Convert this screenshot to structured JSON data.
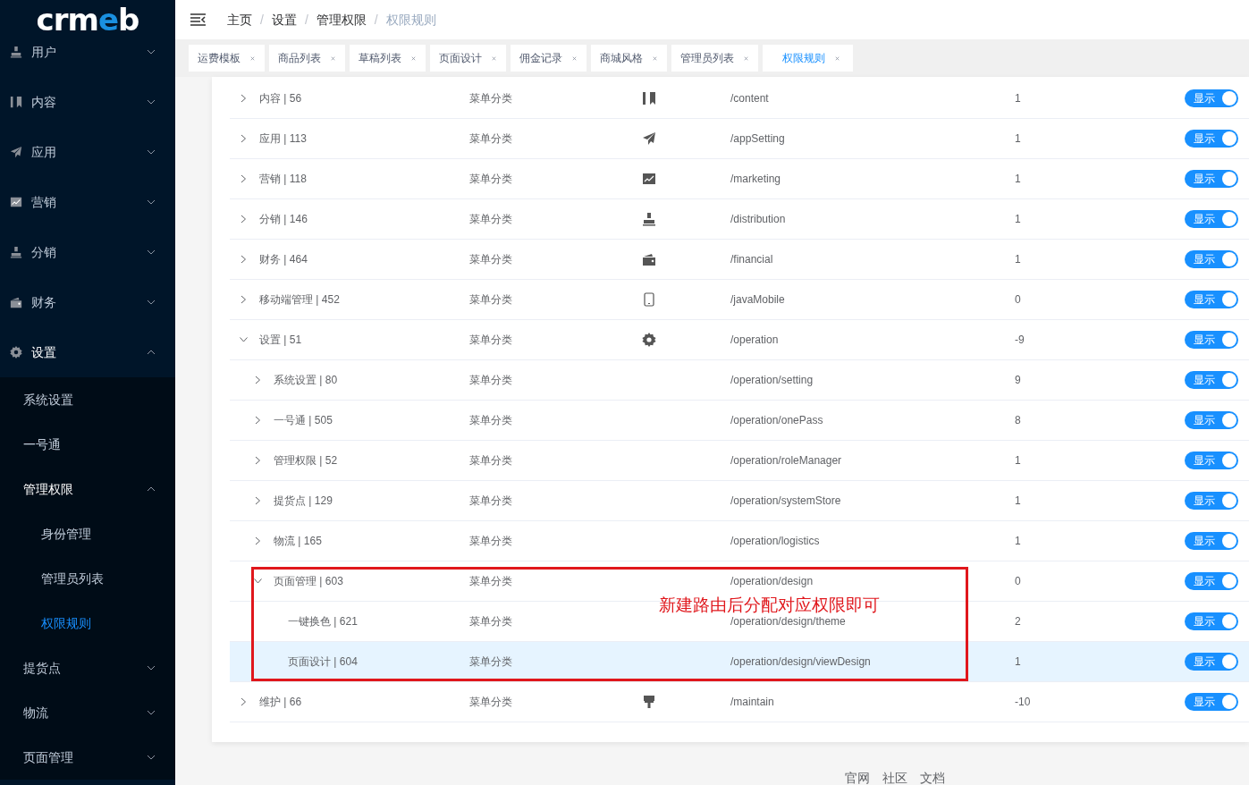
{
  "logo": "crmeb",
  "sidebar": {
    "items": [
      {
        "label": "用户",
        "expanded": false,
        "selected": false
      },
      {
        "label": "内容",
        "expanded": false,
        "selected": false
      },
      {
        "label": "应用",
        "expanded": false,
        "selected": false
      },
      {
        "label": "营销",
        "expanded": false,
        "selected": false
      },
      {
        "label": "分销",
        "expanded": false,
        "selected": false
      },
      {
        "label": "财务",
        "expanded": false,
        "selected": false
      },
      {
        "label": "设置",
        "expanded": true,
        "selected": false,
        "children": [
          {
            "label": "系统设置",
            "selected": false
          },
          {
            "label": "一号通",
            "selected": false
          },
          {
            "label": "管理权限",
            "expanded": true,
            "selected": false,
            "children": [
              {
                "label": "身份管理",
                "selected": false
              },
              {
                "label": "管理员列表",
                "selected": false
              },
              {
                "label": "权限规则",
                "selected": true
              }
            ]
          },
          {
            "label": "提货点",
            "expanded": false,
            "selected": false
          },
          {
            "label": "物流",
            "expanded": false,
            "selected": false
          },
          {
            "label": "页面管理",
            "expanded": false,
            "selected": false
          }
        ]
      }
    ]
  },
  "breadcrumb": {
    "separator": "/",
    "items": [
      "主页",
      "设置",
      "管理权限",
      "权限规则"
    ]
  },
  "tabs": [
    {
      "label": "运费模板",
      "selected": false
    },
    {
      "label": "商品列表",
      "selected": false
    },
    {
      "label": "草稿列表",
      "selected": false
    },
    {
      "label": "页面设计",
      "selected": false
    },
    {
      "label": "佣金记录",
      "selected": false
    },
    {
      "label": "商城风格",
      "selected": false
    },
    {
      "label": "管理员列表",
      "selected": false
    },
    {
      "label": "权限规则",
      "selected": true
    }
  ],
  "rules": [
    {
      "name": "内容 | 56",
      "type": "菜单分类",
      "path": "/content",
      "sort": "1",
      "status": {
        "label": "显示",
        "on": true
      },
      "expanded": false,
      "selected": false
    },
    {
      "name": "应用 | 113",
      "type": "菜单分类",
      "path": "/appSetting",
      "sort": "1",
      "status": {
        "label": "显示",
        "on": true
      },
      "expanded": false,
      "selected": false
    },
    {
      "name": "营销 | 118",
      "type": "菜单分类",
      "path": "/marketing",
      "sort": "1",
      "status": {
        "label": "显示",
        "on": true
      },
      "expanded": false,
      "selected": false
    },
    {
      "name": "分销 | 146",
      "type": "菜单分类",
      "path": "/distribution",
      "sort": "1",
      "status": {
        "label": "显示",
        "on": true
      },
      "expanded": false,
      "selected": false
    },
    {
      "name": "财务 | 464",
      "type": "菜单分类",
      "path": "/financial",
      "sort": "1",
      "status": {
        "label": "显示",
        "on": true
      },
      "expanded": false,
      "selected": false
    },
    {
      "name": "移动端管理 | 452",
      "type": "菜单分类",
      "path": "/javaMobile",
      "sort": "0",
      "status": {
        "label": "显示",
        "on": true
      },
      "expanded": false,
      "selected": false
    },
    {
      "name": "设置 | 51",
      "type": "菜单分类",
      "path": "/operation",
      "sort": "-9",
      "status": {
        "label": "显示",
        "on": true
      },
      "expanded": true,
      "selected": false,
      "children": [
        {
          "name": "系统设置 | 80",
          "type": "菜单分类",
          "path": "/operation/setting",
          "sort": "9",
          "status": {
            "label": "显示",
            "on": true
          },
          "expanded": false,
          "selected": false
        },
        {
          "name": "一号通 | 505",
          "type": "菜单分类",
          "path": "/operation/onePass",
          "sort": "8",
          "status": {
            "label": "显示",
            "on": true
          },
          "expanded": false,
          "selected": false
        },
        {
          "name": "管理权限 | 52",
          "type": "菜单分类",
          "path": "/operation/roleManager",
          "sort": "1",
          "status": {
            "label": "显示",
            "on": true
          },
          "expanded": false,
          "selected": false
        },
        {
          "name": "提货点 | 129",
          "type": "菜单分类",
          "path": "/operation/systemStore",
          "sort": "1",
          "status": {
            "label": "显示",
            "on": true
          },
          "expanded": false,
          "selected": false
        },
        {
          "name": "物流 | 165",
          "type": "菜单分类",
          "path": "/operation/logistics",
          "sort": "1",
          "status": {
            "label": "显示",
            "on": true
          },
          "expanded": false,
          "selected": false
        },
        {
          "name": "页面管理 | 603",
          "type": "菜单分类",
          "path": "/operation/design",
          "sort": "0",
          "status": {
            "label": "显示",
            "on": true
          },
          "expanded": true,
          "selected": false,
          "children": [
            {
              "name": "一键换色 | 621",
              "type": "菜单分类",
              "path": "/operation/design/theme",
              "sort": "2",
              "status": {
                "label": "显示",
                "on": true
              },
              "selected": false
            },
            {
              "name": "页面设计 | 604",
              "type": "菜单分类",
              "path": "/operation/design/viewDesign",
              "sort": "1",
              "status": {
                "label": "显示",
                "on": true
              },
              "selected": true
            }
          ]
        }
      ]
    },
    {
      "name": "维护 | 66",
      "type": "菜单分类",
      "path": "/maintain",
      "sort": "-10",
      "status": {
        "label": "显示",
        "on": true
      },
      "expanded": false,
      "selected": false
    }
  ],
  "annotation": "新建路由后分配对应权限即可",
  "footer_links": [
    "官网",
    "社区",
    "文档"
  ]
}
